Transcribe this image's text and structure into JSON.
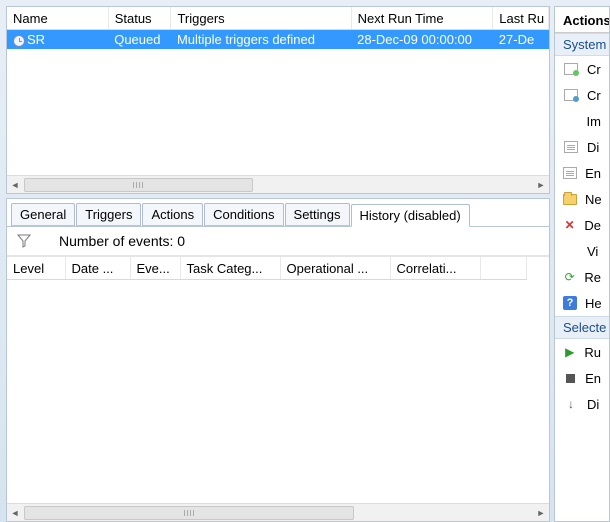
{
  "topGrid": {
    "headers": [
      "Name",
      "Status",
      "Triggers",
      "Next Run Time",
      "Last Ru"
    ],
    "row": {
      "name": "SR",
      "status": "Queued",
      "triggers": "Multiple triggers defined",
      "next": "28-Dec-09 00:00:00",
      "last": "27-De"
    }
  },
  "tabs": {
    "items": [
      "General",
      "Triggers",
      "Actions",
      "Conditions",
      "Settings",
      "History (disabled)"
    ],
    "activeIndex": 5
  },
  "events": {
    "count_label": "Number of events: 0",
    "headers": [
      "Level",
      "Date ...",
      "Eve...",
      "Task Categ...",
      "Operational ...",
      "Correlati..."
    ]
  },
  "actions": {
    "title": "Actions",
    "sub1": "System",
    "items1": [
      "Cr",
      "Cr",
      "Im",
      "Di",
      "En",
      "Ne",
      "De",
      "Vi",
      "Re",
      "He"
    ],
    "sub2": "Selecte",
    "items2": [
      "Ru",
      "En",
      "Di"
    ]
  }
}
